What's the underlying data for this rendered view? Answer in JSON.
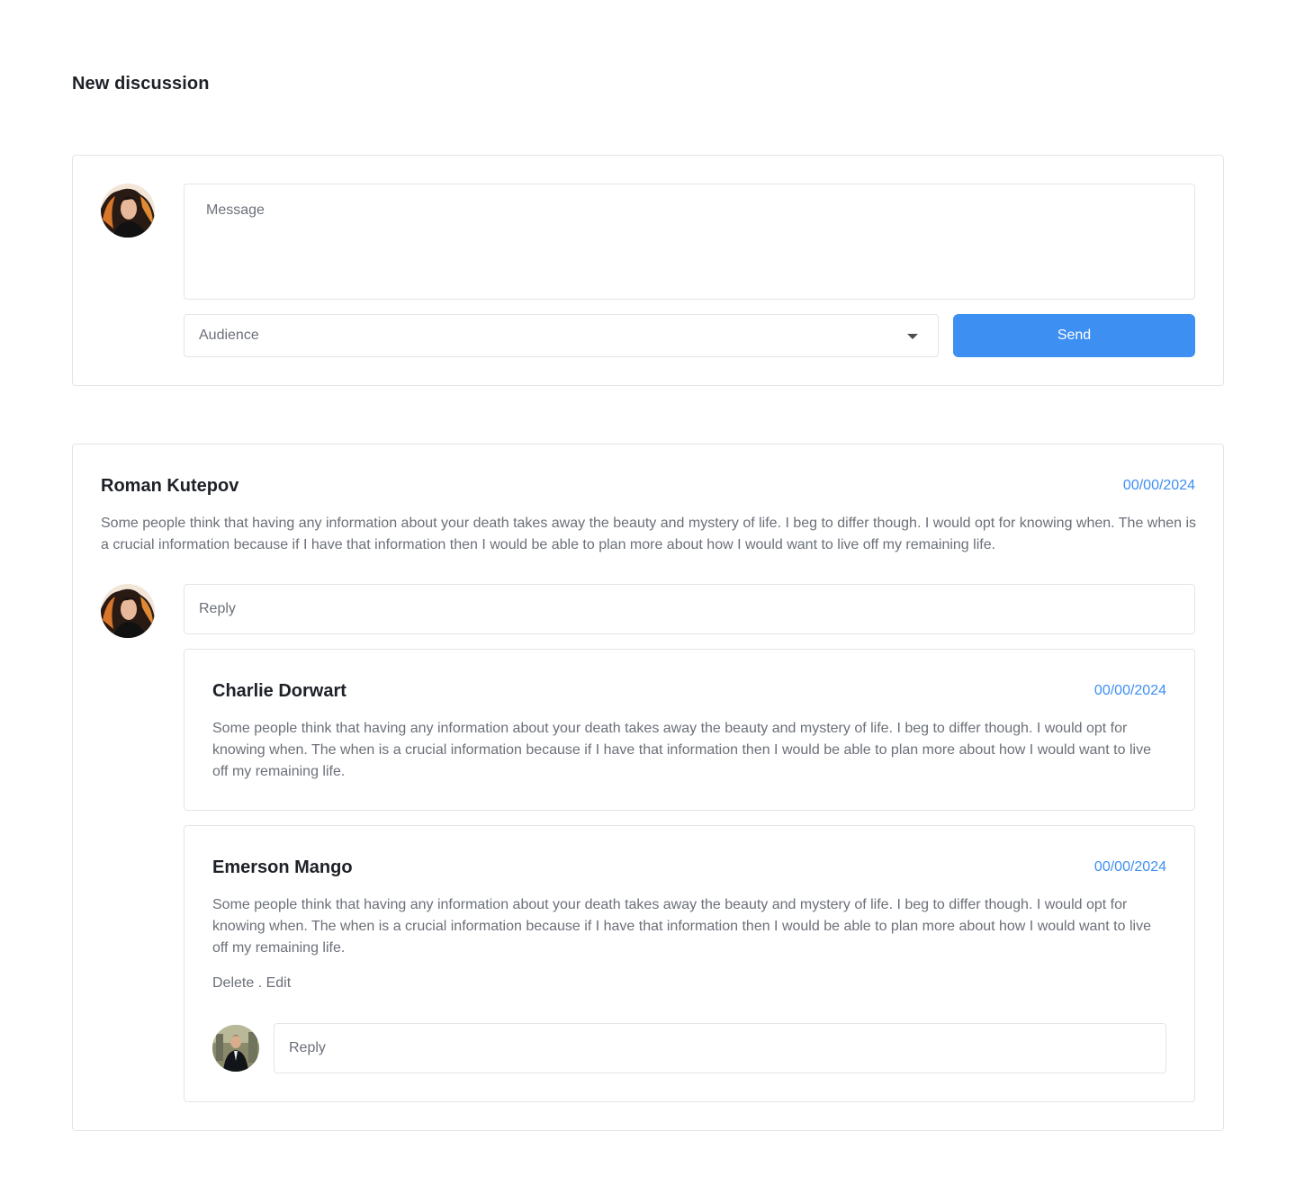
{
  "page": {
    "title": "New discussion"
  },
  "composer": {
    "message_placeholder": "Message",
    "audience_label": "Audience",
    "send_label": "Send"
  },
  "thread": {
    "author": "Roman Kutepov",
    "date": "00/00/2024",
    "body": "Some people think that having any information about your death takes away the beauty and mystery of life. I beg to differ though. I would opt for knowing when. The when is a crucial information because if I have that information then I would be able to plan more about how I would want to live off my remaining life.",
    "reply_placeholder": "Reply",
    "replies": [
      {
        "author": "Charlie Dorwart",
        "date": "00/00/2024",
        "body": "Some people think that having any information about your death takes away the beauty and mystery of life. I beg to differ though. I would opt for knowing when. The when is a crucial information because if I have that information then I would be able to plan more about how I would want to live off my remaining life."
      },
      {
        "author": "Emerson Mango",
        "date": "00/00/2024",
        "body": "Some people think that having any information about your death takes away the beauty and mystery of life. I beg to differ though. I would opt for knowing when. The when is a crucial information because if I have that information then I would be able to plan more about how I would want to live off my remaining life.",
        "delete_label": "Delete",
        "separator": " . ",
        "edit_label": "Edit",
        "reply_placeholder": "Reply"
      }
    ]
  },
  "colors": {
    "accent": "#3d8ff1",
    "border": "#e3e5e8",
    "muted_text": "#6b7078",
    "heading_text": "#1d2127"
  },
  "icons": {
    "dropdown": "caret-down-icon",
    "avatar_current_user": "avatar-woman-orange-hair",
    "avatar_nested_reply": "avatar-man-suit"
  }
}
